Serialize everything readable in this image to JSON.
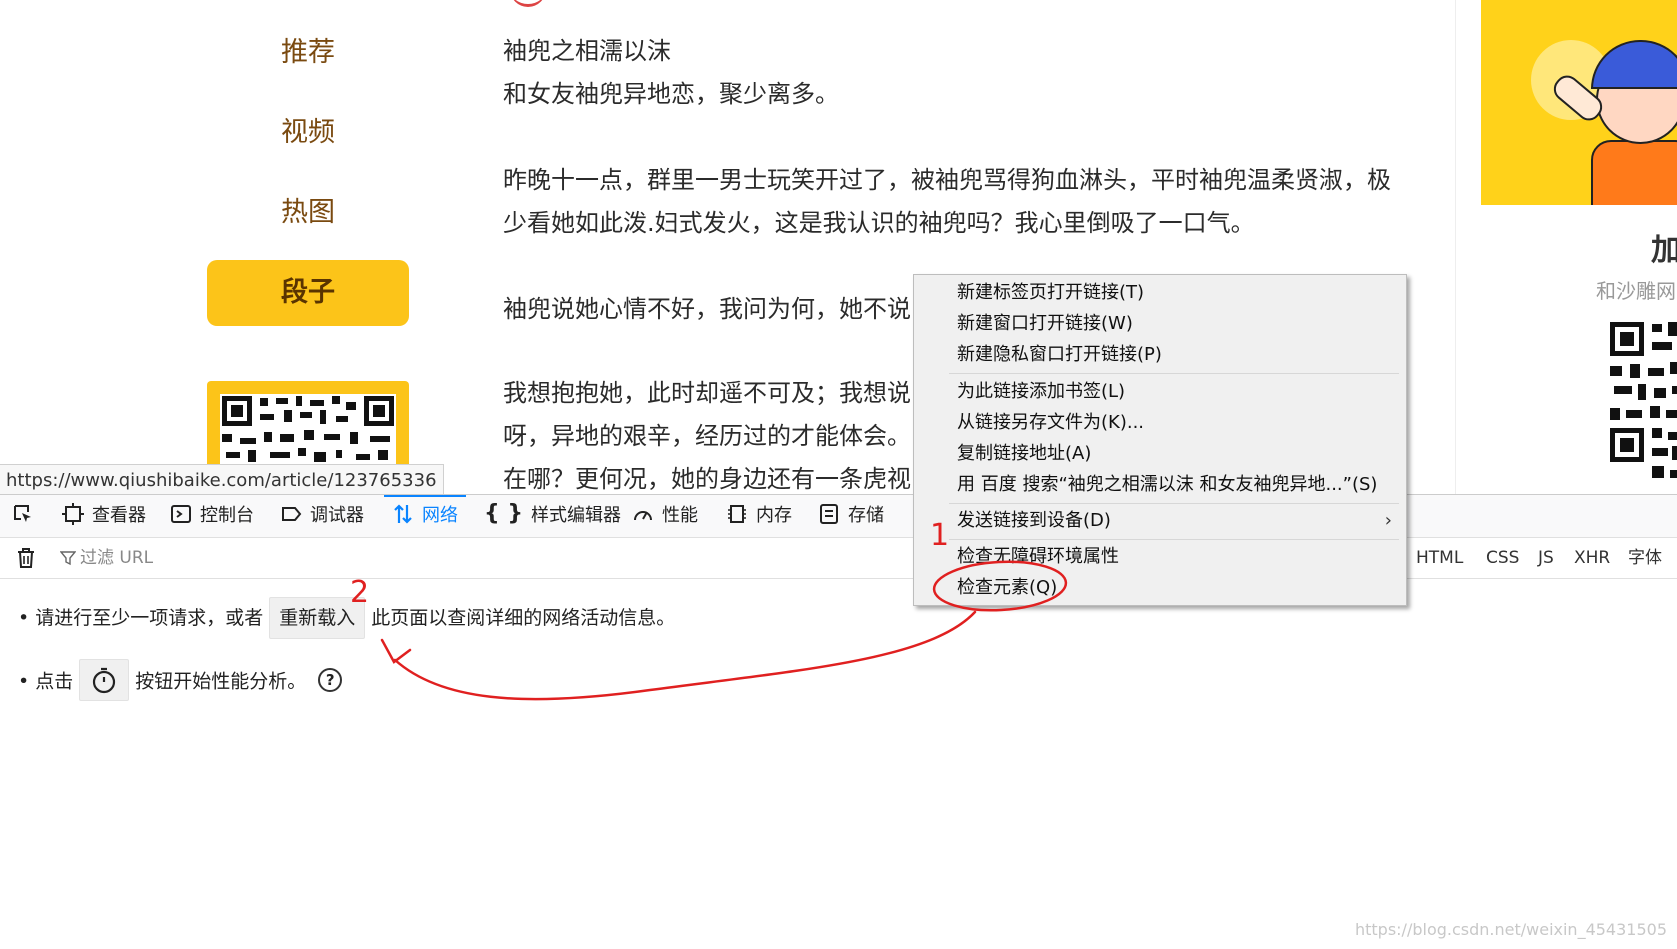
{
  "sidebar": {
    "items": [
      {
        "label": "推荐"
      },
      {
        "label": "视频"
      },
      {
        "label": "热图"
      },
      {
        "label": "段子",
        "active": true
      }
    ]
  },
  "article": {
    "paragraphs": [
      [
        "袖兜之相濡以沫",
        "和女友袖兜异地恋，聚少离多。"
      ],
      [
        "昨晚十一点，群里一男士玩笑开过了，被袖兜骂得狗血淋头，平时袖兜温柔贤淑，极",
        "少看她如此泼.妇式发火，这是我认识的袖兜吗？我心里倒吸了一口气。"
      ],
      [
        "袖兜说她心情不好，我问为何，她不说"
      ],
      [
        "我想抱抱她，此时却遥不可及；我想说",
        "呀，异地的艰辛，经历过的才能体会。",
        "在哪？更何况，她的身边还有一条虎视"
      ]
    ]
  },
  "right_panel": {
    "join_text": "加",
    "join_sub": "和沙雕网"
  },
  "status_url": "https://www.qiushibaike.com/article/123765336",
  "devtools": {
    "tabs": [
      {
        "label": "查看器",
        "icon": "inspector-icon"
      },
      {
        "label": "控制台",
        "icon": "console-icon"
      },
      {
        "label": "调试器",
        "icon": "debugger-icon"
      },
      {
        "label": "网络",
        "icon": "network-icon",
        "selected": true
      },
      {
        "label": "样式编辑器",
        "icon": "style-editor-icon"
      },
      {
        "label": "性能",
        "icon": "performance-icon"
      },
      {
        "label": "内存",
        "icon": "memory-icon"
      },
      {
        "label": "存储",
        "icon": "storage-icon"
      }
    ],
    "filter_placeholder": "过滤 URL",
    "filter_types": [
      "HTML",
      "CSS",
      "JS",
      "XHR",
      "字体"
    ],
    "message1_prefix": "• 请进行至少一项请求，或者",
    "reload_button": "重新载入",
    "message1_suffix": "此页面以查阅详细的网络活动信息。",
    "message2_prefix": "• 点击",
    "message2_suffix": "按钮开始性能分析。",
    "help_glyph": "?"
  },
  "context_menu": {
    "items": [
      {
        "label": "新建标签页打开链接(T)"
      },
      {
        "label": "新建窗口打开链接(W)"
      },
      {
        "label": "新建隐私窗口打开链接(P)"
      },
      {
        "label": "为此链接添加书签(L)"
      },
      {
        "label": "从链接另存文件为(K)..."
      },
      {
        "label": "复制链接地址(A)"
      },
      {
        "label": "用 百度 搜索“袖兜之相濡以沫 和女友袖兜异地...”(S)"
      },
      {
        "label": "发送链接到设备(D)",
        "submenu": true
      },
      {
        "label": "检查无障碍环境属性"
      },
      {
        "label": "检查元素(Q)"
      }
    ],
    "submenu_arrow": "›"
  },
  "annotation": {
    "color": "#e02020",
    "label_1": "1",
    "label_2": "2"
  },
  "watermark": "https://blog.csdn.net/weixin_45431505"
}
